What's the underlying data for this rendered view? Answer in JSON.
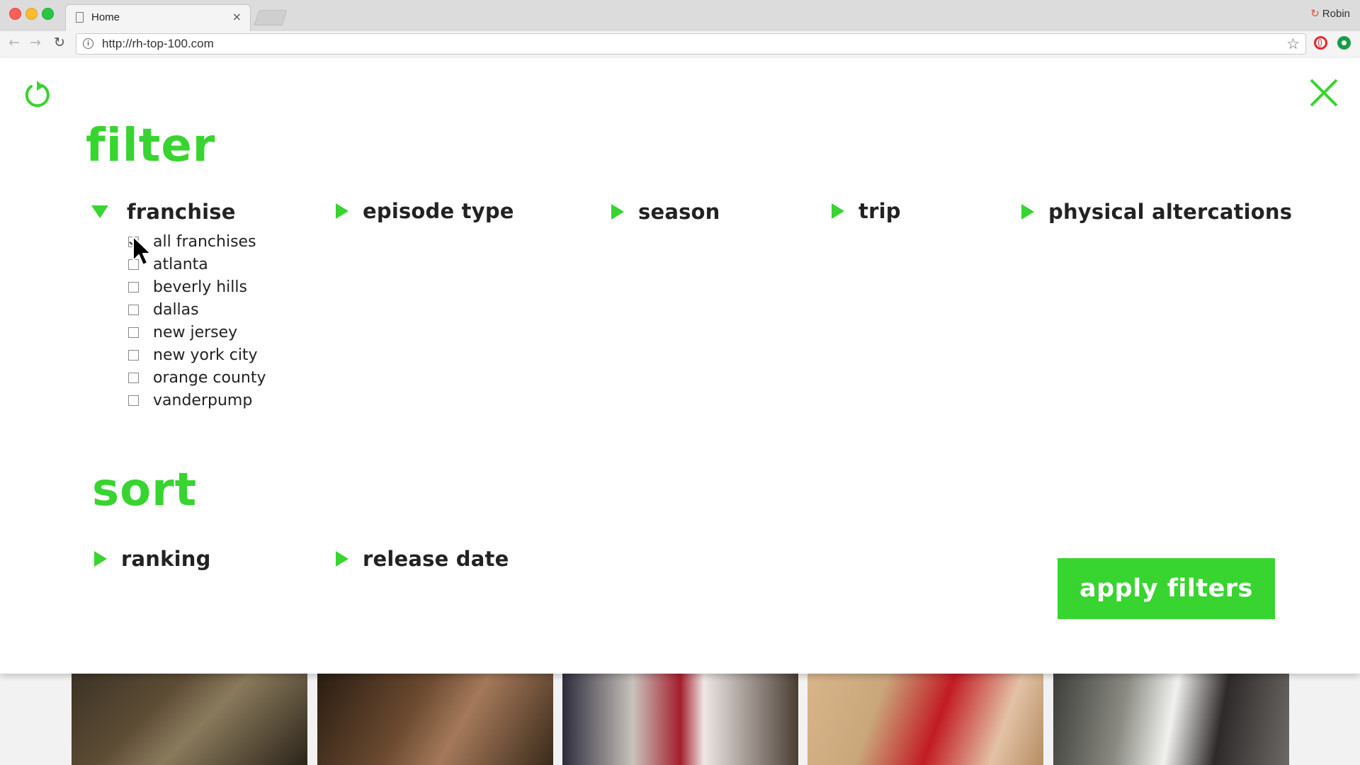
{
  "browser": {
    "tab_title": "Home",
    "tab_close": "×",
    "profile_name": "Robin",
    "url": "http://rh-top-100.com",
    "nav": {
      "back": "←",
      "forward": "→",
      "reload": "↻"
    },
    "star": "☆"
  },
  "filter": {
    "heading": "filter",
    "sections": [
      {
        "label": "franchise",
        "expanded": true
      },
      {
        "label": "episode type",
        "expanded": false
      },
      {
        "label": "season",
        "expanded": false
      },
      {
        "label": "trip",
        "expanded": false
      },
      {
        "label": "physical altercations",
        "expanded": false
      }
    ],
    "franchise_options": [
      {
        "label": "all franchises",
        "checked": true
      },
      {
        "label": "atlanta",
        "checked": false
      },
      {
        "label": "beverly hills",
        "checked": false
      },
      {
        "label": "dallas",
        "checked": false
      },
      {
        "label": "new jersey",
        "checked": false
      },
      {
        "label": "new york city",
        "checked": false
      },
      {
        "label": "orange county",
        "checked": false
      },
      {
        "label": "vanderpump",
        "checked": false
      }
    ]
  },
  "sort": {
    "heading": "sort",
    "sections": [
      {
        "label": "ranking"
      },
      {
        "label": "release date"
      }
    ]
  },
  "apply_button": "apply filters",
  "icons": {
    "reset": "reset-icon",
    "close": "close-icon",
    "accent_color": "#38d430"
  }
}
